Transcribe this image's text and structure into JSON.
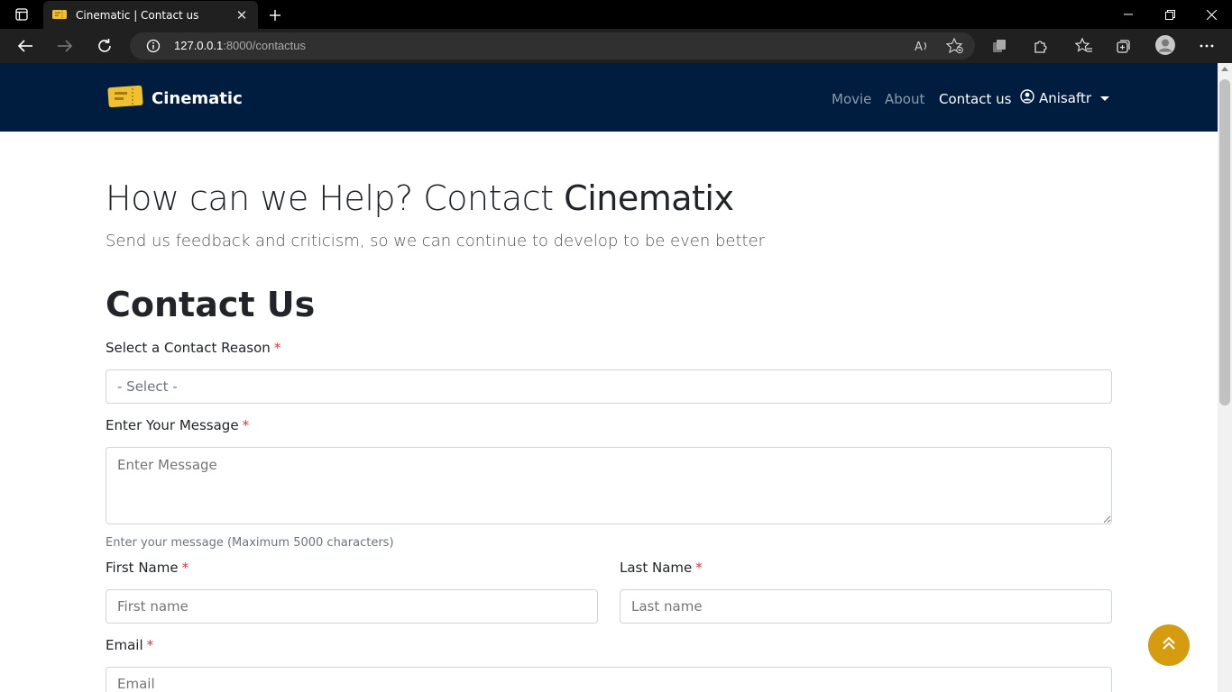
{
  "browser": {
    "tab_title": "Cinematic | Contact us",
    "tab_close": "✕",
    "url_host": "127.0.0.1",
    "url_path": ":8000/contactus"
  },
  "nav": {
    "brand": "Cinematic",
    "links": [
      "Movie",
      "About",
      "Contact us"
    ],
    "user": "Anisaftr"
  },
  "hero": {
    "title_prefix": "How can we Help? Contact ",
    "title_brand": "Cinematix",
    "subtitle": "Send us feedback and criticism, so we can continue to develop to be even better"
  },
  "form": {
    "title": "Contact Us",
    "required_mark": "*",
    "reason_label": "Select a Contact Reason",
    "reason_value": "- Select -",
    "message_label": "Enter Your Message",
    "message_placeholder": "Enter Message",
    "message_help": "Enter your message (Maximum 5000 characters)",
    "first_name_label": "First Name",
    "first_name_placeholder": "First name",
    "last_name_label": "Last Name",
    "last_name_placeholder": "Last name",
    "email_label": "Email",
    "email_placeholder": "Email"
  },
  "colors": {
    "navbar": "#001c3f",
    "accent": "#d49c0e",
    "required": "#dc3545"
  }
}
